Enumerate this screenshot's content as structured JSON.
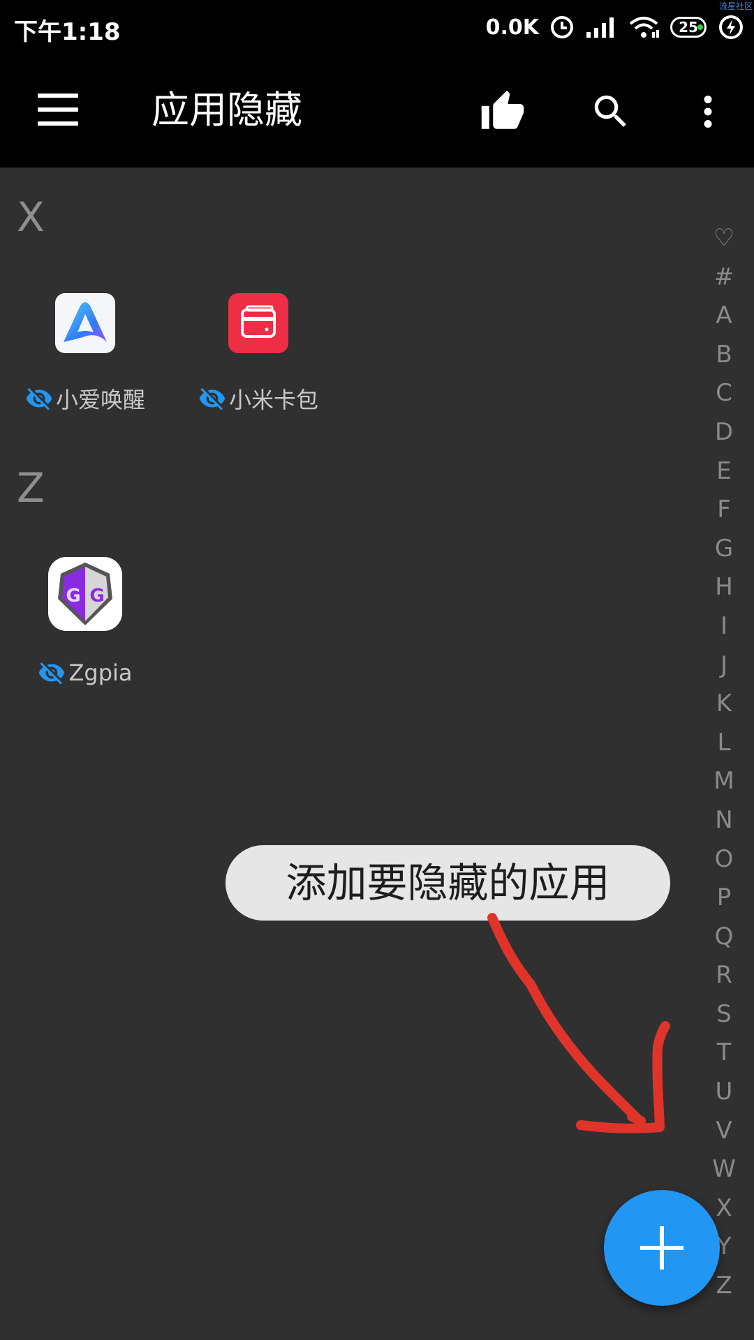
{
  "status_bar": {
    "time": "下午1:18",
    "network_speed": "0.0K",
    "battery": "25",
    "watermark": "流星社区",
    "icons": [
      "alarm-icon",
      "signal-icon",
      "wifi-icon",
      "battery-icon",
      "charging-icon"
    ]
  },
  "toolbar": {
    "title": "应用隐藏",
    "icons": [
      "menu-icon",
      "thumbs-up-icon",
      "search-icon",
      "more-vert-icon"
    ]
  },
  "sections": [
    {
      "letter": "X",
      "apps": [
        {
          "name": "小爱唤醒",
          "icon": "xiaoai-app-icon",
          "hidden": true
        },
        {
          "name": "小米卡包",
          "icon": "card-wallet-app-icon",
          "hidden": true
        }
      ]
    },
    {
      "letter": "Z",
      "apps": [
        {
          "name": "Zgpia",
          "icon": "gg-app-icon",
          "hidden": true
        }
      ]
    }
  ],
  "alphabet_index": [
    "♡",
    "#",
    "A",
    "B",
    "C",
    "D",
    "E",
    "F",
    "G",
    "H",
    "I",
    "J",
    "K",
    "L",
    "M",
    "N",
    "O",
    "P",
    "Q",
    "R",
    "S",
    "T",
    "U",
    "V",
    "W",
    "X",
    "Y",
    "Z"
  ],
  "tooltip": {
    "text": "添加要隐藏的应用"
  },
  "fab": {
    "icon": "plus-icon"
  },
  "colors": {
    "background": "#303030",
    "toolbar": "#000000",
    "accent": "#2196f3",
    "hidden_eye": "#2196f3",
    "annotation_arrow": "#e0342b",
    "tooltip_bg": "#e6e6e6"
  }
}
